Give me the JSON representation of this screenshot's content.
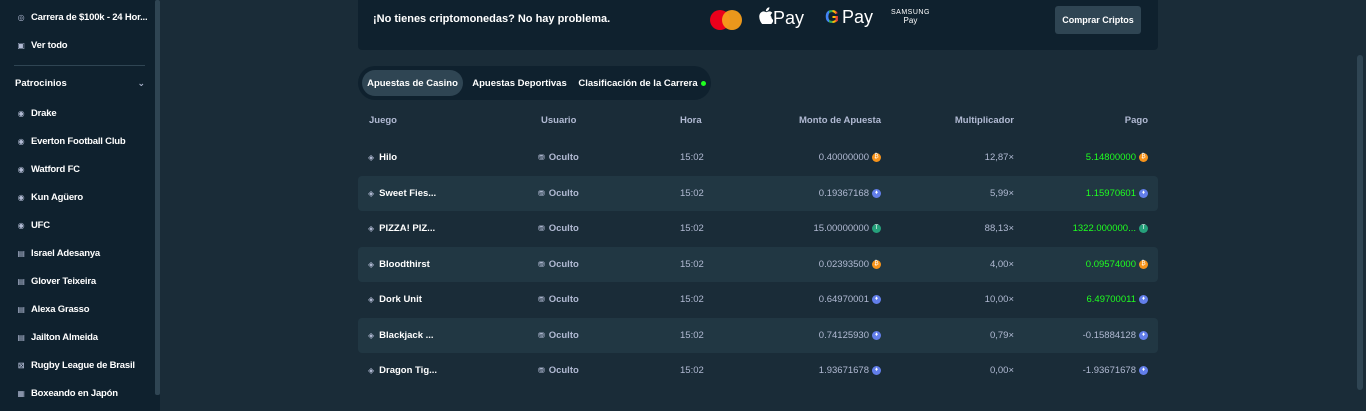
{
  "sidebar": {
    "top_items": [
      {
        "label": "Carrera de $100k - 24 Hor...",
        "icon": "race-icon"
      },
      {
        "label": "Ver todo",
        "icon": "gift-icon"
      }
    ],
    "section_title": "Patrocinios",
    "items": [
      {
        "label": "Drake",
        "icon": "sponsor-icon"
      },
      {
        "label": "Everton Football Club",
        "icon": "football-icon"
      },
      {
        "label": "Watford FC",
        "icon": "football-icon"
      },
      {
        "label": "Kun Agüero",
        "icon": "football-icon"
      },
      {
        "label": "UFC",
        "icon": "sponsor-icon"
      },
      {
        "label": "Israel Adesanya",
        "icon": "fighter-icon"
      },
      {
        "label": "Glover Teixeira",
        "icon": "fighter-icon"
      },
      {
        "label": "Alexa Grasso",
        "icon": "fighter-icon"
      },
      {
        "label": "Jailton Almeida",
        "icon": "fighter-icon"
      },
      {
        "label": "Rugby League de Brasil",
        "icon": "rugby-icon"
      },
      {
        "label": "Boxeando en Japón",
        "icon": "boxing-icon"
      }
    ]
  },
  "banner": {
    "text": "¡No tienes criptomonedas? No hay problema.",
    "apple_pay": "Pay",
    "google_pay": "Pay",
    "samsung_pay_top": "SAMSUNG",
    "samsung_pay_bottom": "Pay",
    "buy_button": "Comprar Criptos"
  },
  "tabs": [
    {
      "label": "Apuestas de Casino",
      "active": true
    },
    {
      "label": "Apuestas Deportivas",
      "active": false
    },
    {
      "label": "Clasificación de la Carrera",
      "active": false,
      "live_dot": true
    }
  ],
  "table": {
    "headers": {
      "game": "Juego",
      "user": "Usuario",
      "time": "Hora",
      "amount": "Monto de Apuesta",
      "multiplier": "Multiplicador",
      "payout": "Pago"
    },
    "rows": [
      {
        "game": "Hilo",
        "user": "Oculto",
        "time": "15:02",
        "amount": "0.40000000",
        "coin": "BTC",
        "multiplier": "12,87×",
        "payout": "5.14800000",
        "win": true
      },
      {
        "game": "Sweet Fies...",
        "user": "Oculto",
        "time": "15:02",
        "amount": "0.19367168",
        "coin": "ETH",
        "multiplier": "5,99×",
        "payout": "1.15970601",
        "win": true
      },
      {
        "game": "PIZZA! PIZ...",
        "user": "Oculto",
        "time": "15:02",
        "amount": "15.00000000",
        "coin": "USDT",
        "multiplier": "88,13×",
        "payout": "1322.000000...",
        "win": true
      },
      {
        "game": "Bloodthirst",
        "user": "Oculto",
        "time": "15:02",
        "amount": "0.02393500",
        "coin": "BTC",
        "multiplier": "4,00×",
        "payout": "0.09574000",
        "win": true
      },
      {
        "game": "Dork Unit",
        "user": "Oculto",
        "time": "15:02",
        "amount": "0.64970001",
        "coin": "ETH",
        "multiplier": "10,00×",
        "payout": "6.49700011",
        "win": true
      },
      {
        "game": "Blackjack ...",
        "user": "Oculto",
        "time": "15:02",
        "amount": "0.74125930",
        "coin": "ETH",
        "multiplier": "0,79×",
        "payout": "-0.15884128",
        "win": false
      },
      {
        "game": "Dragon Tig...",
        "user": "Oculto",
        "time": "15:02",
        "amount": "1.93671678",
        "coin": "ETH",
        "multiplier": "0,00×",
        "payout": "-1.93671678",
        "win": false
      }
    ]
  },
  "colors": {
    "win": "#1fff20",
    "btc": "#f7931a",
    "eth": "#627eea",
    "usdt": "#26a17b"
  }
}
